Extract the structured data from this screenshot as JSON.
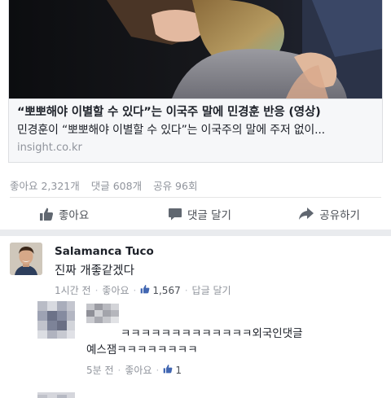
{
  "post": {
    "link": {
      "title": "“뽀뽀해야 이별할 수 있다”는 이국주 말에 민경훈 반응 (영상)",
      "description": "민경훈이 “뽀뽀해야 이별할 수 있다”는 이국주의 말에 주저 없이...",
      "domain": "insight.co.kr"
    },
    "stats": {
      "likes": "좋아요 2,321개",
      "comments": "댓글 608개",
      "shares": "공유 96회"
    },
    "actions": {
      "like": "좋아요",
      "comment": "댓글 달기",
      "share": "공유하기"
    }
  },
  "comments": [
    {
      "author": "Salamanca Tuco",
      "text": "진짜 개좋같겠다",
      "time": "1시간 전",
      "like_label": "좋아요",
      "like_count": "1,567",
      "reply_label": "답글 달기"
    },
    {
      "text_line1": "ㅋㅋㅋㅋㅋㅋㅋㅋㅋㅋㅋㅋㅋ외국인댓글",
      "text_line2": "예스잼ㅋㅋㅋㅋㅋㅋㅋㅋ",
      "time": "5분 전",
      "like_label": "좋아요",
      "like_count": "1"
    }
  ],
  "colors": {
    "facebook_blue": "#4267b2",
    "meta_gray": "#90949c",
    "text_dark": "#1d2129",
    "action_gray": "#4b4f56"
  },
  "icons": {
    "like": "thumbs-up-icon",
    "comment": "speech-bubble-icon",
    "share": "share-arrow-icon"
  }
}
